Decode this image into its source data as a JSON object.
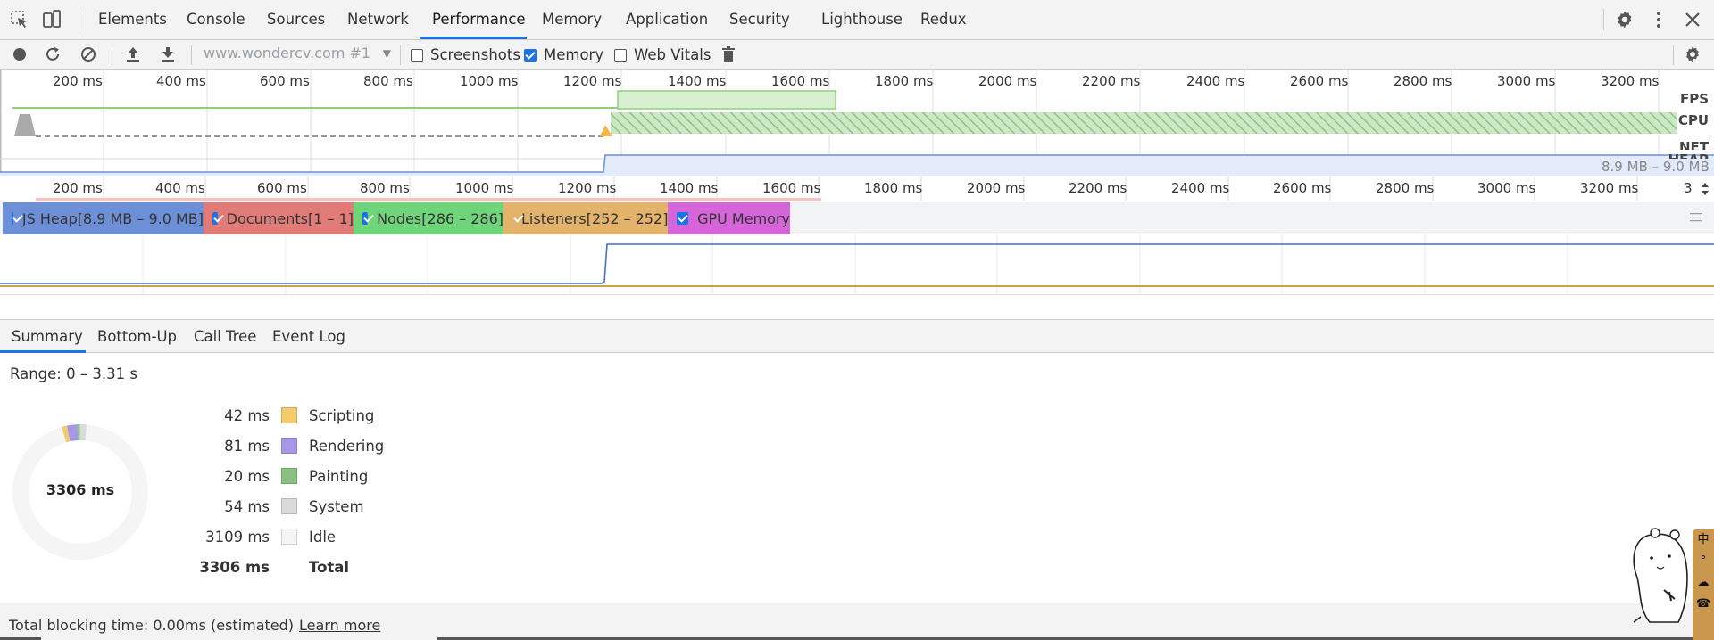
{
  "tabs": {
    "items": [
      "Elements",
      "Console",
      "Sources",
      "Network",
      "Performance",
      "Memory",
      "Application",
      "Security",
      "Lighthouse",
      "Redux"
    ],
    "active": "Performance"
  },
  "toolbar": {
    "url_value": "www.wondercv.com #1",
    "screenshots_label": "Screenshots",
    "screenshots_checked": false,
    "memory_label": "Memory",
    "memory_checked": true,
    "webvitals_label": "Web Vitals",
    "webvitals_checked": false
  },
  "overview": {
    "ticks": [
      "200 ms",
      "400 ms",
      "600 ms",
      "800 ms",
      "1000 ms",
      "1200 ms",
      "1400 ms",
      "1600 ms",
      "1800 ms",
      "2000 ms",
      "2200 ms",
      "2400 ms",
      "2600 ms",
      "2800 ms",
      "3000 ms",
      "3200 ms"
    ],
    "labels": {
      "fps": "FPS",
      "cpu": "CPU",
      "net": "NET",
      "heap": "HEAP"
    },
    "heap_range": "8.9 MB – 9.0 MB"
  },
  "ruler2": {
    "ticks": [
      "200 ms",
      "400 ms",
      "600 ms",
      "800 ms",
      "1000 ms",
      "1200 ms",
      "1400 ms",
      "1600 ms",
      "1800 ms",
      "2000 ms",
      "2200 ms",
      "2400 ms",
      "2600 ms",
      "2800 ms",
      "3000 ms",
      "3200 ms",
      "3"
    ]
  },
  "counters": [
    {
      "label": "JS Heap[8.9 MB – 9.0 MB]",
      "color": "#6d8fd8"
    },
    {
      "label": "Documents[1 – 1]",
      "color": "#e07b78"
    },
    {
      "label": "Nodes[286 – 286]",
      "color": "#6fd47a"
    },
    {
      "label": "Listeners[252 – 252]",
      "color": "#e3b26b"
    },
    {
      "label": "GPU Memory",
      "color": "#d565d8"
    }
  ],
  "details_tabs": {
    "items": [
      "Summary",
      "Bottom-Up",
      "Call Tree",
      "Event Log"
    ],
    "active": "Summary"
  },
  "summary": {
    "range": "Range: 0 – 3.31 s",
    "total_center": "3306 ms",
    "rows": [
      {
        "value": "42 ms",
        "label": "Scripting",
        "color": "#f2cb6d",
        "ms": 42
      },
      {
        "value": "81 ms",
        "label": "Rendering",
        "color": "#a896e8",
        "ms": 81
      },
      {
        "value": "20 ms",
        "label": "Painting",
        "color": "#89c27f",
        "ms": 20
      },
      {
        "value": "54 ms",
        "label": "System",
        "color": "#dadada",
        "ms": 54
      },
      {
        "value": "3109 ms",
        "label": "Idle",
        "color": "#f5f5f5",
        "ms": 3109
      }
    ],
    "total": {
      "value": "3306 ms",
      "label": "Total"
    }
  },
  "footer": {
    "blocking": "Total blocking time: 0.00ms (estimated)",
    "learn_more": "Learn more"
  },
  "side_strip": [
    "中",
    "°",
    "☁",
    "☎"
  ]
}
